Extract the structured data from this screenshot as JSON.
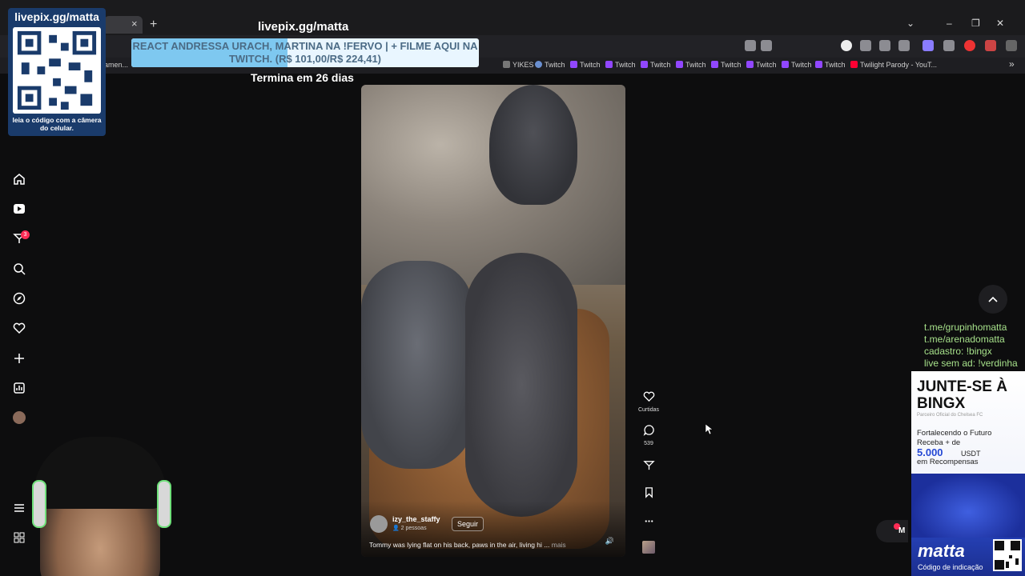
{
  "browser": {
    "tab_close": "×",
    "new_tab": "+",
    "window_controls": {
      "expand": "⌄",
      "minimize": "–",
      "restore": "❐",
      "close": "✕"
    },
    "bookmarks": [
      {
        "label": "amen...",
        "icon": "dark"
      },
      {
        "label": "YIKES",
        "icon": "dark"
      },
      {
        "label": "Twitch",
        "icon": "globe"
      },
      {
        "label": "Twitch",
        "icon": "twitch"
      },
      {
        "label": "Twitch",
        "icon": "twitch"
      },
      {
        "label": "Twitch",
        "icon": "twitch"
      },
      {
        "label": "Twitch",
        "icon": "twitch"
      },
      {
        "label": "Twitch",
        "icon": "twitch"
      },
      {
        "label": "Twitch",
        "icon": "twitch"
      },
      {
        "label": "Twitch",
        "icon": "twitch"
      },
      {
        "label": "Twilight Parody - YouT...",
        "icon": "youtube"
      }
    ],
    "bookmarks_overflow": "»"
  },
  "sidebar": {
    "items": [
      {
        "name": "home-icon"
      },
      {
        "name": "live-icon"
      },
      {
        "name": "inbox-icon",
        "badge": "3"
      },
      {
        "name": "search-icon"
      },
      {
        "name": "explore-icon"
      },
      {
        "name": "following-icon"
      },
      {
        "name": "upload-icon"
      },
      {
        "name": "analytics-icon"
      },
      {
        "name": "profile-avatar"
      },
      {
        "name": "menu-icon"
      },
      {
        "name": "apps-icon"
      }
    ]
  },
  "video": {
    "author": "izy_the_staffy",
    "author_sub": "👤 2 pessoas",
    "follow_label": "Seguir",
    "caption": "Tommy was lying flat on his back, paws in the air, living hi ...",
    "caption_more": "mais"
  },
  "actions": {
    "like_label": "Curtidas",
    "comments_count": "539"
  },
  "overlay": {
    "qr_title": "livepix.gg/matta",
    "qr_footer": "leia o código com a câmera do celular.",
    "stream_title": "livepix.gg/matta",
    "goal_text": "REACT ANDRESSA URACH, MARTINA NA !FERVO | + FILME AQUI NA TWITCH. (R$ 101,00/R$ 224,41)",
    "goal_progress": 0.45,
    "goal_ends": "Termina em 26 dias",
    "links": [
      "t.me/grupinhomatta",
      "t.me/arenadomatta",
      "cadastro: !bingx",
      "live sem ad: !verdinha"
    ],
    "bingx": {
      "headline": "JUNTE-SE À BINGX",
      "partner": "Parceiro Oficial do Chelsea FC",
      "line1": "Fortalecendo o Futuro",
      "line2": "Receba + de",
      "amount": "5.000",
      "currency": "USDT",
      "line3": "em Recompensas",
      "brand": "matta",
      "brand_sub": "Código de indicação"
    },
    "chat_label": "M"
  },
  "colors": {
    "accent_red": "#fe2c55",
    "goal_fill": "#7ec8f0",
    "links_green": "#a6e08a",
    "bingx_blue": "#2447d4"
  }
}
